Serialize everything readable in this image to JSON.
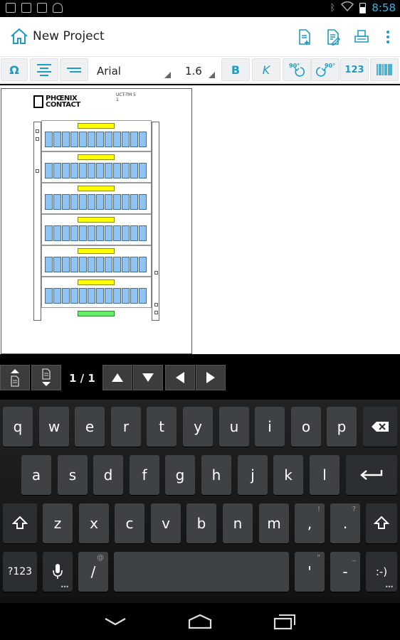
{
  "status_bar": {
    "time": "8:58",
    "left_icons": [
      "download-icon",
      "play-store-icon",
      "clipboard-check-icon",
      "android-icon"
    ],
    "right_icons": [
      "bluetooth-icon",
      "wifi-icon",
      "battery-icon"
    ]
  },
  "action_bar": {
    "title": "New Project",
    "actions": [
      "new-document-icon",
      "edit-document-icon",
      "print-icon",
      "overflow-menu-icon"
    ]
  },
  "format_toolbar": {
    "symbol_label": "Ω",
    "font": "Arial",
    "size": "1.6",
    "bold_label": "B",
    "italic_label": "K",
    "rotate_ccw_label": "90°",
    "rotate_cw_label": "90°",
    "numbering_label": "123",
    "colors": {
      "accent": "#1e9cc4",
      "button_bg": "#eef0f1"
    }
  },
  "document": {
    "logo_text": "PHŒNIX\nCONTACT",
    "code_line1": "UCT-TM 5",
    "code_line2": "1",
    "colors": {
      "cell": "#8ec3f3",
      "label_yellow": "#ffff00",
      "label_green": "#66ee66"
    }
  },
  "page_nav": {
    "counter": "1 / 1"
  },
  "keyboard": {
    "row1": [
      {
        "k": "q"
      },
      {
        "k": "w"
      },
      {
        "k": "e"
      },
      {
        "k": "r"
      },
      {
        "k": "t"
      },
      {
        "k": "y"
      },
      {
        "k": "u"
      },
      {
        "k": "i"
      },
      {
        "k": "o"
      },
      {
        "k": "p"
      }
    ],
    "row2": [
      {
        "k": "a"
      },
      {
        "k": "s"
      },
      {
        "k": "d"
      },
      {
        "k": "f"
      },
      {
        "k": "g"
      },
      {
        "k": "h"
      },
      {
        "k": "j"
      },
      {
        "k": "k"
      },
      {
        "k": "l"
      }
    ],
    "row3": [
      {
        "k": "z"
      },
      {
        "k": "x"
      },
      {
        "k": "c"
      },
      {
        "k": "v"
      },
      {
        "k": "b"
      },
      {
        "k": "n"
      },
      {
        "k": "m"
      }
    ],
    "comma": ",",
    "comma_hint": "!",
    "period": ".",
    "period_hint": "?",
    "symbols_label": "?123",
    "slash": "/",
    "slash_hint": "@",
    "apostrophe": "'",
    "apostrophe_hint": "\"",
    "dash": "-",
    "dash_hint": "_",
    "smiley": ":-)"
  },
  "system_nav": [
    "back-icon",
    "home-icon",
    "recent-apps-icon"
  ]
}
